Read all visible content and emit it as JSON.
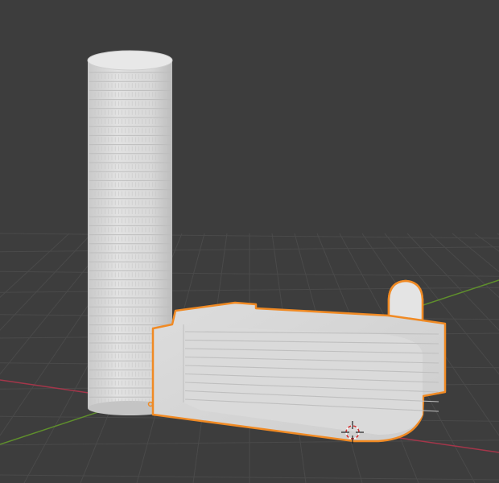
{
  "viewport": {
    "mode": "3d-viewport",
    "background": "#3d3d3d",
    "grid_color": "#4a4a4a",
    "x_axis_color": "#b3364a",
    "y_axis_color": "#6a9b2f",
    "selection_outline_color": "#f08a24",
    "model_color": "#d9d9d9"
  },
  "objects": [
    {
      "name": "tower",
      "shape": "cylinder",
      "selected": false
    },
    {
      "name": "podium",
      "shape": "rounded-block",
      "selected": true
    }
  ],
  "cursor": {
    "name": "3d-cursor",
    "icon": "crosshair-icon"
  }
}
